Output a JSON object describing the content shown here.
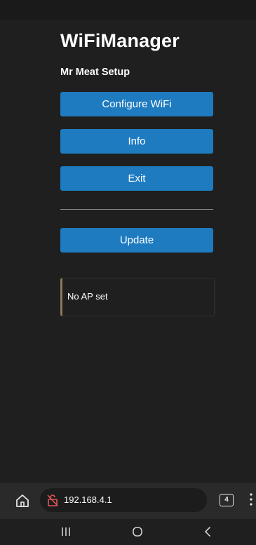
{
  "page": {
    "title": "WiFiManager",
    "subtitle": "Mr Meat Setup"
  },
  "buttons": {
    "configure_wifi": "Configure WiFi",
    "info": "Info",
    "exit": "Exit",
    "update": "Update"
  },
  "message": {
    "text": "No AP set"
  },
  "browser": {
    "url": "192.168.4.1",
    "tab_count": "4",
    "icons": {
      "home": "home-icon",
      "lock": "not-secure-icon",
      "tabs": "tabs-icon",
      "menu": "more-vert-icon"
    }
  },
  "nav": {
    "icons": [
      "recents-icon",
      "home-icon",
      "back-icon"
    ]
  },
  "colors": {
    "background": "#1f1f1f",
    "button": "#1e7bc0",
    "message_accent": "#8a7a55",
    "text": "#ffffff"
  }
}
